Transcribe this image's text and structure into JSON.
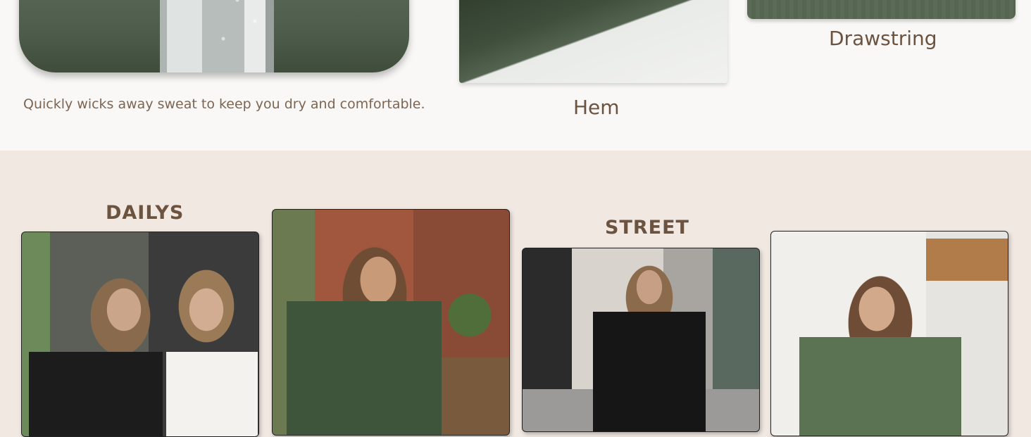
{
  "features": {
    "wicking_caption": "Quickly wicks away sweat to keep you dry and comfortable.",
    "hem_label": "Hem",
    "drawstring_label": "Drawstring"
  },
  "styles": {
    "dailys_heading": "DAILYS",
    "street_heading": "STREET"
  },
  "colors": {
    "top_background": "#f9f8f6",
    "bottom_background": "#f1e8e2",
    "text_brown": "#6b5340",
    "fabric_green": "#4e5d4b"
  }
}
